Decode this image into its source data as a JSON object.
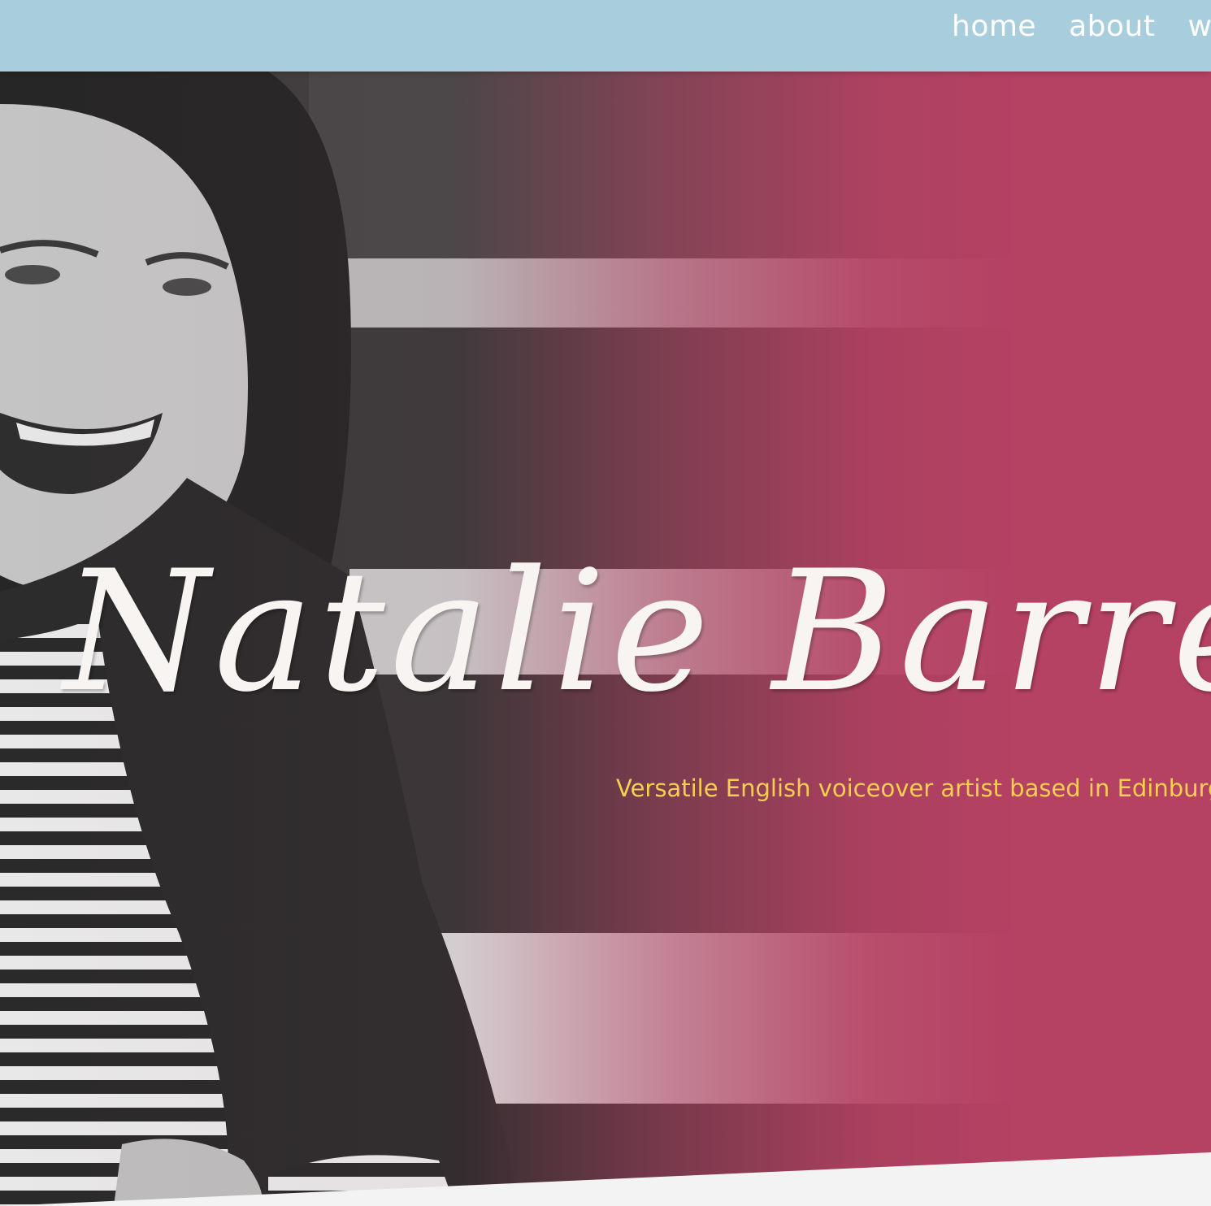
{
  "nav": {
    "links": [
      "home",
      "about",
      "work"
    ]
  },
  "hero": {
    "title": "Natalie Barrett",
    "subtitle": "Versatile English voiceover artist based in Edinburgh"
  },
  "colors": {
    "nav_background": "#a8cddd",
    "hero_accent": "#b54163",
    "title_color": "#f7f4f2",
    "subtitle_color": "#f6cf52",
    "page_background": "#f3f3f3"
  }
}
